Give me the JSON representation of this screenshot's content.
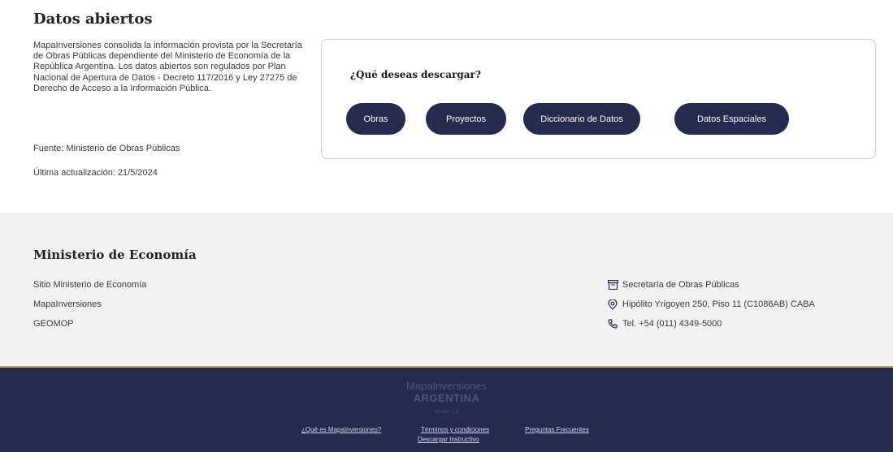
{
  "header": {
    "title": "Datos abiertos",
    "description": "MapaInversiones consolida la información provista por la Secretaría de Obras Públicas dependiente del Ministerio de Economía de la República Argentina. Los datos abiertos son regulados por Plan Nacional de Apertura de Datos - Decreto 117/2016 y Ley 27275 de Derecho de Acceso a la Información Pública.",
    "source": "Fuente: Ministerio de Obras Públicas",
    "updated": "Última actualización: 21/5/2024"
  },
  "download": {
    "question": "¿Qué deseas descargar?",
    "buttons": [
      "Obras",
      "Proyectos",
      "Diccionario de Datos",
      "Datos Espaciales"
    ]
  },
  "footer": {
    "title": "Ministerio de Economía",
    "links": [
      "Sitio Ministerio de Economía",
      "MapaInversiones",
      "GEOMOP"
    ],
    "contact": [
      {
        "icon": "building-icon",
        "text": "Secretaría de Obras Públicas"
      },
      {
        "icon": "location-pin-icon",
        "text": "Hipólito Yrigoyen 250, Piso 11 (C1086AB) CABA"
      },
      {
        "icon": "phone-icon",
        "text": "Tel. +54 (011) 4349-5000"
      }
    ]
  },
  "bottom": {
    "brand_line1": "MapaInversiones",
    "brand_line2": "ARGENTINA",
    "version": "Versión 1.8",
    "links": [
      "¿Qué es MapaInversiones?",
      "Términos y condiciones",
      "Preguntas Frecuentes",
      "Descargar Instructivo"
    ]
  },
  "colors": {
    "primary": "#252a4e",
    "accent": "#c9a46a",
    "footer_bg": "#f2f2f2"
  }
}
